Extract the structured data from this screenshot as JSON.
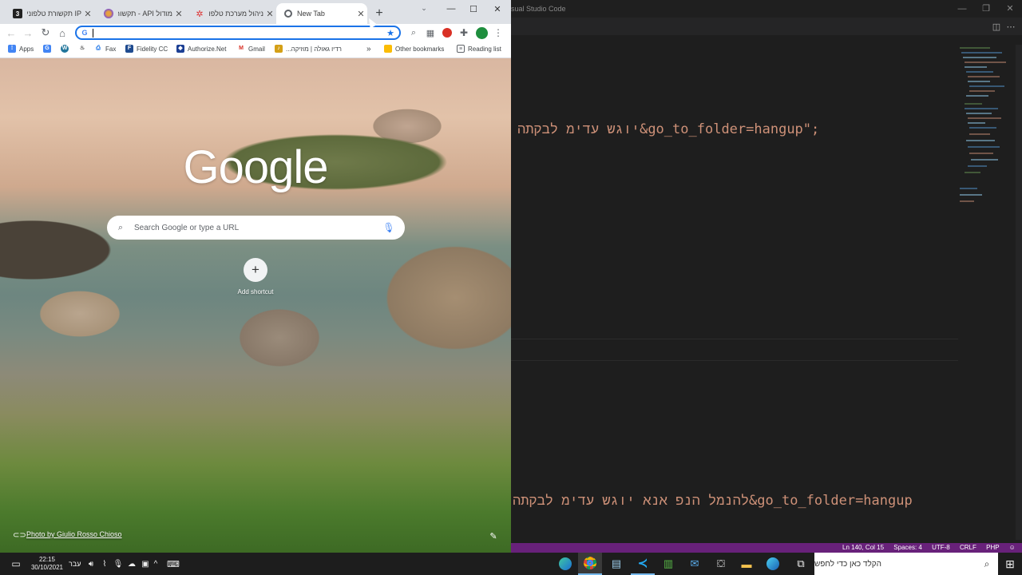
{
  "vscode": {
    "title": "sual Studio Code",
    "code_line_1": "התקבל מידע שגוי&go_to_folder=hangup\";",
    "code_line_2": "התקבל מידע שגוי אנא פנה למנהל&go_to_folder=hangup",
    "status": {
      "position": "Ln 140, Col 15",
      "spaces": "Spaces: 4",
      "encoding": "UTF-8",
      "eol": "CRLF",
      "language": "PHP"
    },
    "colors": {
      "status_bar": "#68217a",
      "editor_bg": "#1e1e1e",
      "string": "#ce9178"
    }
  },
  "chrome": {
    "tabs": [
      {
        "title": "IP תקשורת טלפונית",
        "icon": "tab-favicon-3"
      },
      {
        "title": "מודול API - תקשור",
        "icon": "tab-favicon-api"
      },
      {
        "title": "ניהול מערכת טלפוני",
        "icon": "tab-favicon-phone"
      },
      {
        "title": "New Tab",
        "icon": "chrome-icon"
      }
    ],
    "omnibox_value": "",
    "bookmarks": [
      {
        "label": "Apps"
      },
      {
        "label": "Fax"
      },
      {
        "label": "Fidelity CC"
      },
      {
        "label": "Authorize.Net"
      },
      {
        "label": "Gmail"
      },
      {
        "label": "רדיו גאולה | מוזיקה..."
      }
    ],
    "bookmarks_other": "Other bookmarks",
    "reading_list": "Reading list",
    "ntp": {
      "logo": "Google",
      "search_placeholder": "Search Google or type a URL",
      "add_shortcut": "Add shortcut",
      "photo_credit": "Photo by Giulio Rosso Chioso"
    }
  },
  "taskbar": {
    "time": "22:15",
    "date": "30/10/2021",
    "language": "עבר",
    "search_placeholder": "הקלד כאן כדי לחפש"
  }
}
